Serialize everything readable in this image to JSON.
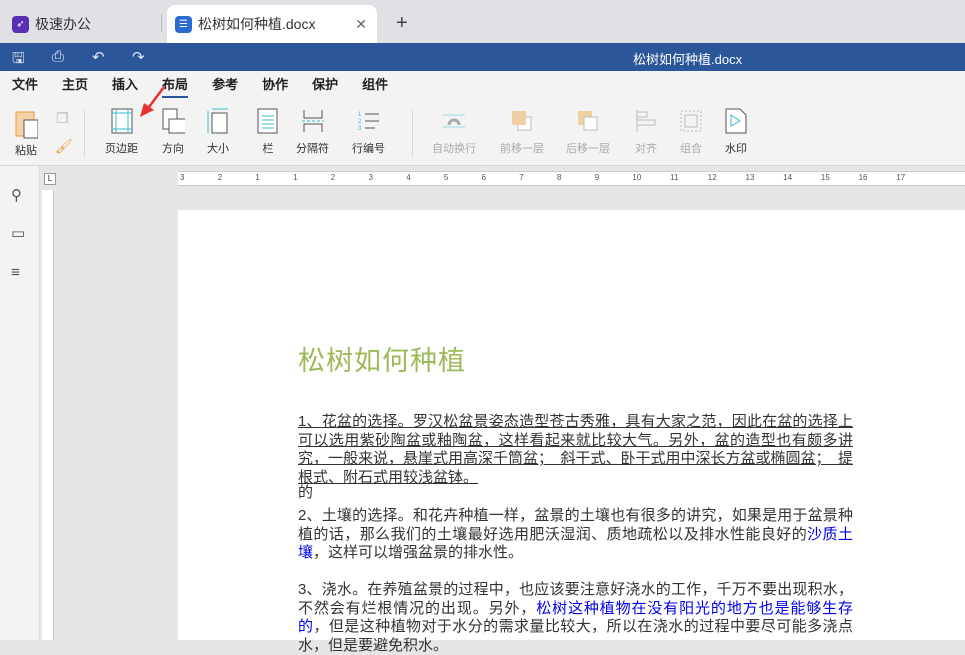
{
  "tabs": {
    "app": "极速办公",
    "doc": "松树如何种植.docx"
  },
  "titlebar": {
    "title": "松树如何种植.docx"
  },
  "menu": [
    "文件",
    "主页",
    "插入",
    "布局",
    "参考",
    "协作",
    "保护",
    "组件"
  ],
  "ribbon": {
    "paste": "粘贴",
    "margins": "页边距",
    "orientation": "方向",
    "size": "大小",
    "columns": "栏",
    "breaks": "分隔符",
    "line_numbers": "行编号",
    "wrap": "自动换行",
    "bring_forward": "前移一层",
    "send_backward": "后移一层",
    "align": "对齐",
    "group": "组合",
    "watermark": "水印"
  },
  "ruler": [
    "3",
    "2",
    "1",
    "1",
    "2",
    "3",
    "4",
    "5",
    "6",
    "7",
    "8",
    "9",
    "10",
    "11",
    "12",
    "13",
    "14",
    "15",
    "16",
    "17"
  ],
  "document": {
    "title": "松树如何种植",
    "p1": "1、花盆的选择。罗汉松盆景姿态造型苍古秀雅，具有大家之范，因此在盆的选择上可以选用紫砂陶盆或釉陶盆，这样看起来就比较大气。另外，盆的造型也有颇多讲究，一般来说，悬崖式用高深千筒盆；　斜干式、卧干式用中深长方盆或椭圆盆；　提根式、附石式用较浅盆钵。",
    "p1b": "的",
    "p2a": "2、土壤的选择。和花卉种植一样，盆景的土壤也有很多的讲究，如果是用于盆景种植的话，那么我们的土壤最好选用肥沃湿润、质地疏松以及排水性能良好的",
    "p2link": "沙质土壤",
    "p2b": "，这样可以增强盆景的排水性。",
    "p3a": "3、浇水。在养殖盆景的过程中，也应该要注意好浇水的工作，千万不要出现积水，不然会有烂根情况的出现。另外，",
    "p3link": "松树这种植物在没有阳光的地方也是能够生存的",
    "p3b": "，但是这种植物对于水分的需求量比较大，所以在浇水的过程中要尽可能多浇点水，但是要避免积水。"
  }
}
